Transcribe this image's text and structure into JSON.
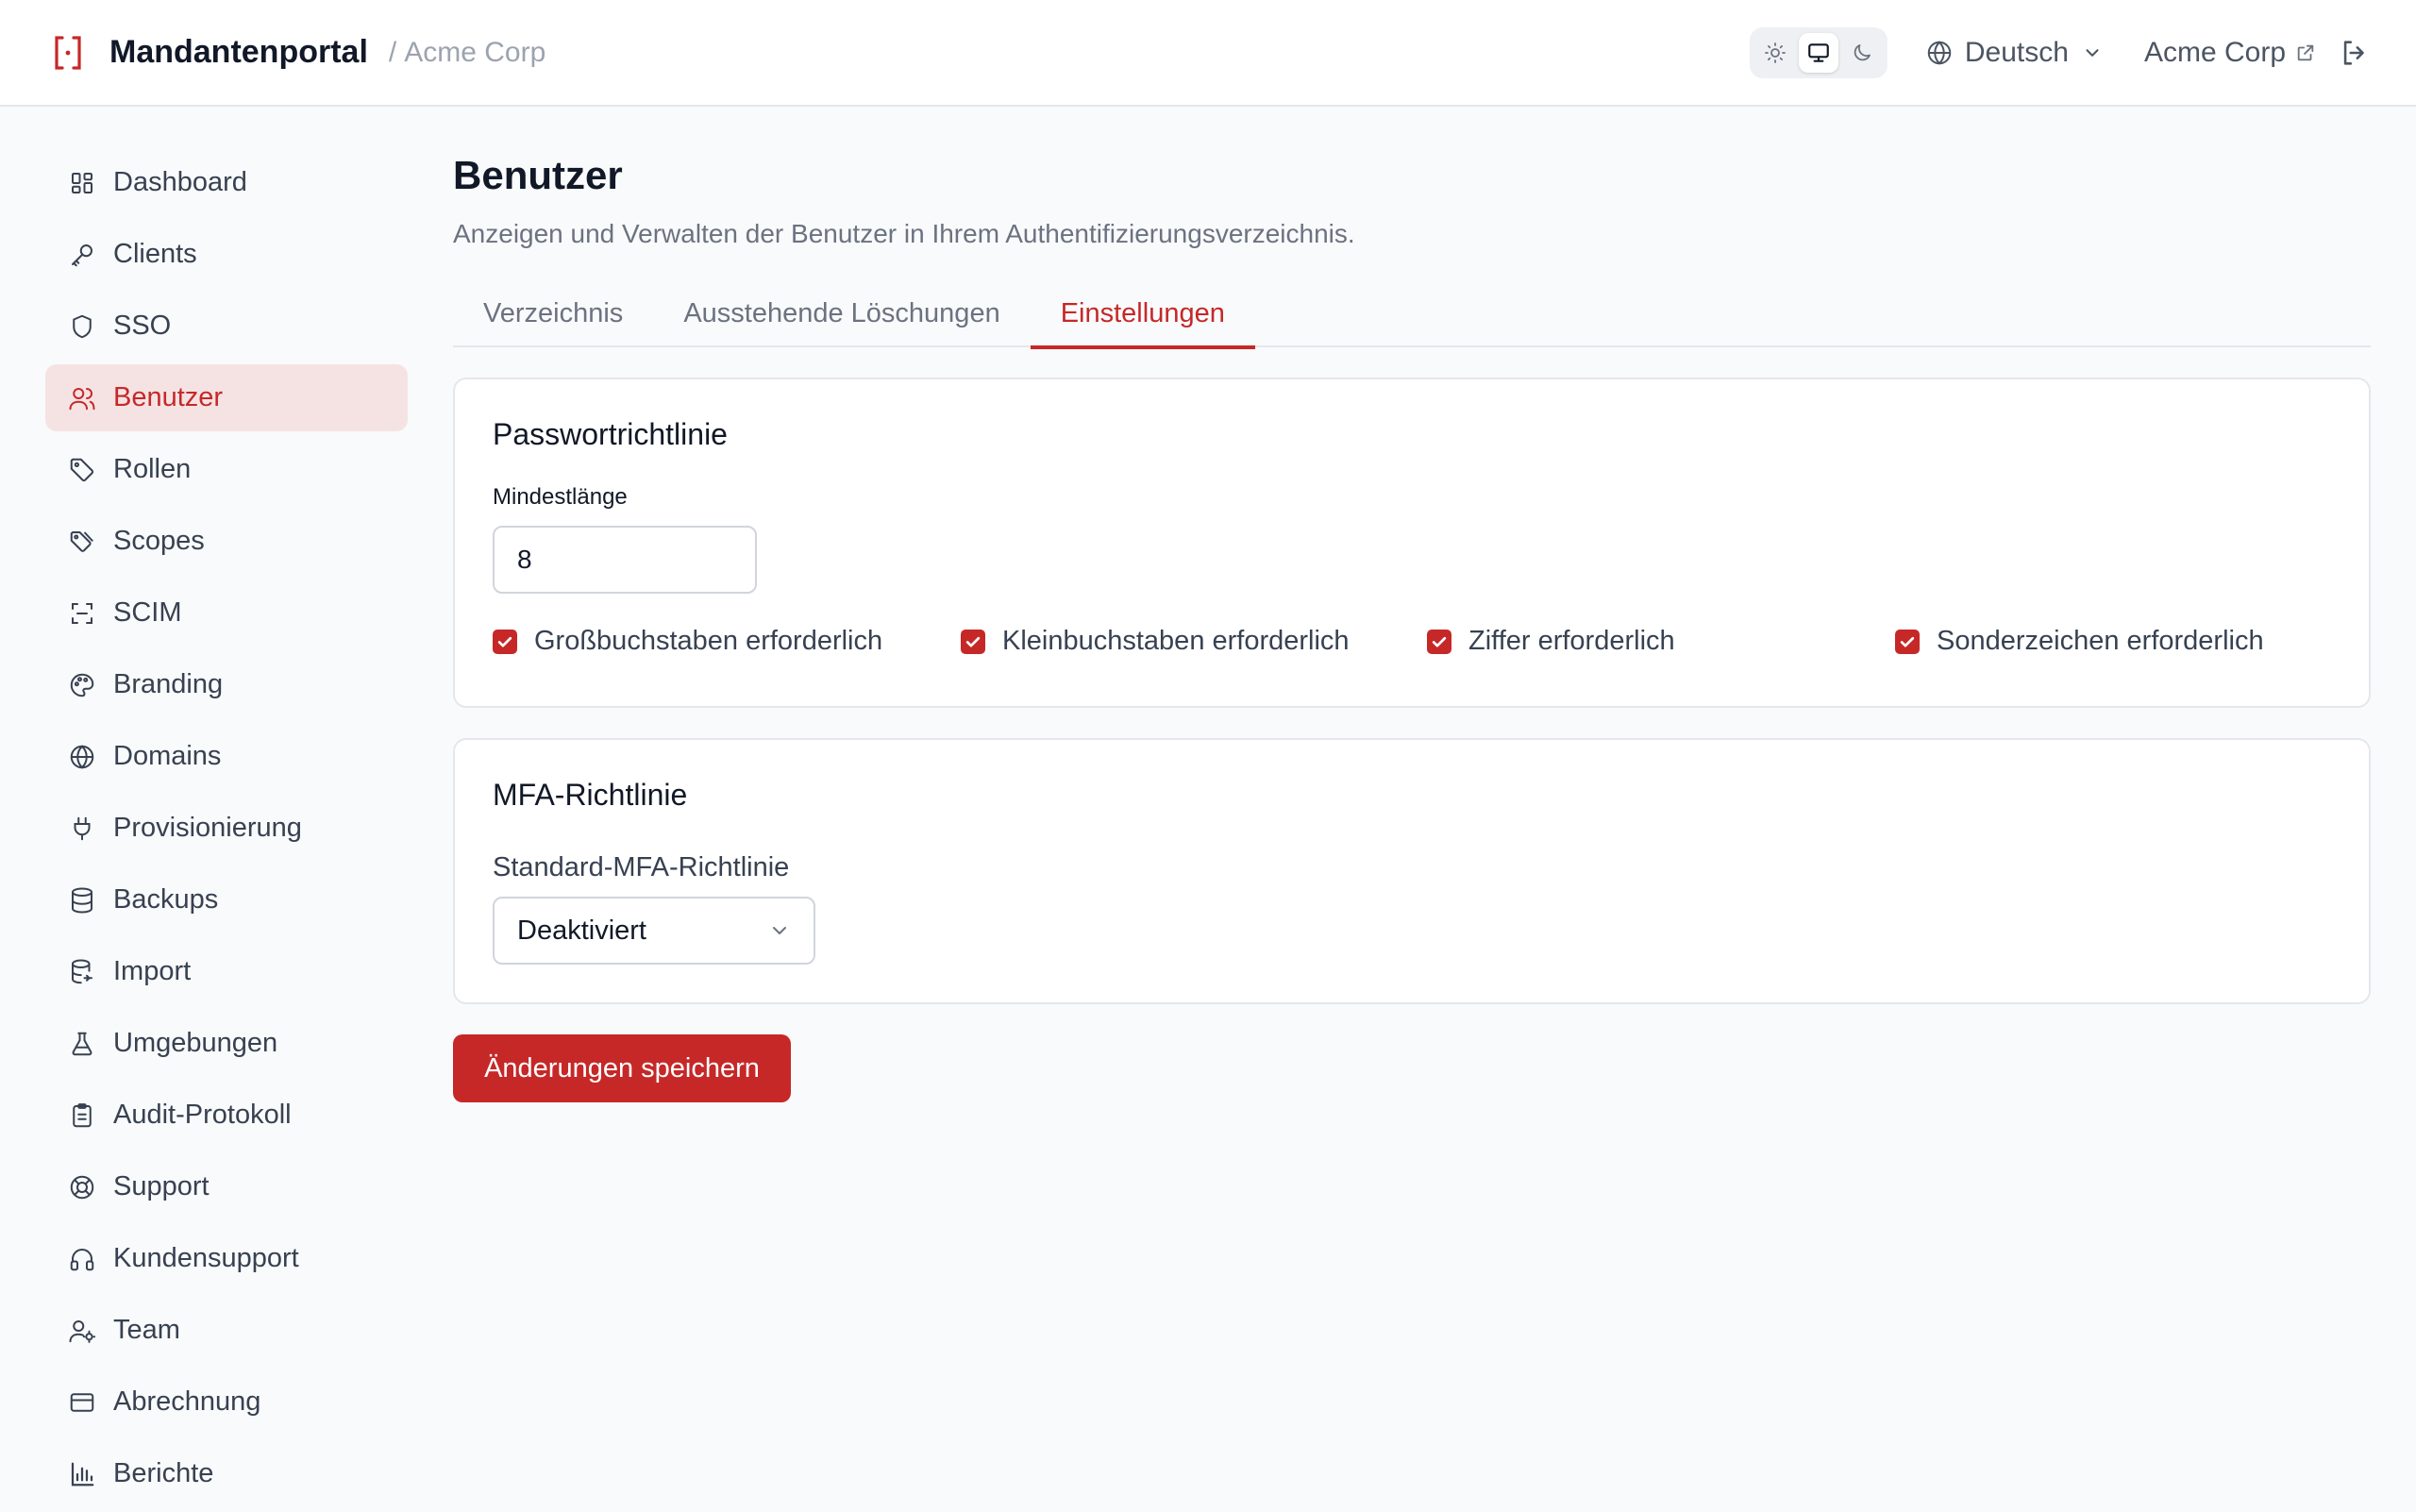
{
  "header": {
    "app_name": "Mandantenportal",
    "separator": "/",
    "tenant": "Acme Corp",
    "theme_options": [
      "light",
      "system",
      "dark"
    ],
    "theme_selected": "system",
    "language": "Deutsch",
    "tenant_link": "Acme Corp"
  },
  "sidebar": {
    "items": [
      {
        "label": "Dashboard",
        "icon": "dashboard-icon"
      },
      {
        "label": "Clients",
        "icon": "key-icon"
      },
      {
        "label": "SSO",
        "icon": "shield-icon"
      },
      {
        "label": "Benutzer",
        "icon": "users-icon",
        "active": true
      },
      {
        "label": "Rollen",
        "icon": "tag-icon"
      },
      {
        "label": "Scopes",
        "icon": "tags-icon"
      },
      {
        "label": "SCIM",
        "icon": "scan-icon"
      },
      {
        "label": "Branding",
        "icon": "palette-icon"
      },
      {
        "label": "Domains",
        "icon": "globe-icon"
      },
      {
        "label": "Provisionierung",
        "icon": "plug-icon"
      },
      {
        "label": "Backups",
        "icon": "database-icon"
      },
      {
        "label": "Import",
        "icon": "database-import-icon"
      },
      {
        "label": "Umgebungen",
        "icon": "flask-icon"
      },
      {
        "label": "Audit-Protokoll",
        "icon": "clipboard-icon"
      },
      {
        "label": "Support",
        "icon": "lifebuoy-icon"
      },
      {
        "label": "Kundensupport",
        "icon": "headphones-icon"
      },
      {
        "label": "Team",
        "icon": "user-cog-icon"
      },
      {
        "label": "Abrechnung",
        "icon": "credit-card-icon"
      },
      {
        "label": "Berichte",
        "icon": "bar-chart-icon"
      }
    ]
  },
  "main": {
    "title": "Benutzer",
    "subtitle": "Anzeigen und Verwalten der Benutzer in Ihrem Authentifizierungsverzeichnis.",
    "tabs": [
      {
        "label": "Verzeichnis"
      },
      {
        "label": "Ausstehende Löschungen"
      },
      {
        "label": "Einstellungen",
        "active": true
      }
    ],
    "password_policy": {
      "title": "Passwortrichtlinie",
      "min_length_label": "Mindestlänge",
      "min_length_value": "8",
      "checkboxes": [
        {
          "label": "Großbuchstaben erforderlich",
          "checked": true
        },
        {
          "label": "Kleinbuchstaben erforderlich",
          "checked": true
        },
        {
          "label": "Ziffer erforderlich",
          "checked": true
        },
        {
          "label": "Sonderzeichen erforderlich",
          "checked": true
        }
      ]
    },
    "mfa_policy": {
      "title": "MFA-Richtlinie",
      "default_label": "Standard-MFA-Richtlinie",
      "default_value": "Deaktiviert"
    },
    "save_label": "Änderungen speichern"
  },
  "colors": {
    "accent": "#c62828",
    "active_nav_bg": "#f5e3e4"
  }
}
